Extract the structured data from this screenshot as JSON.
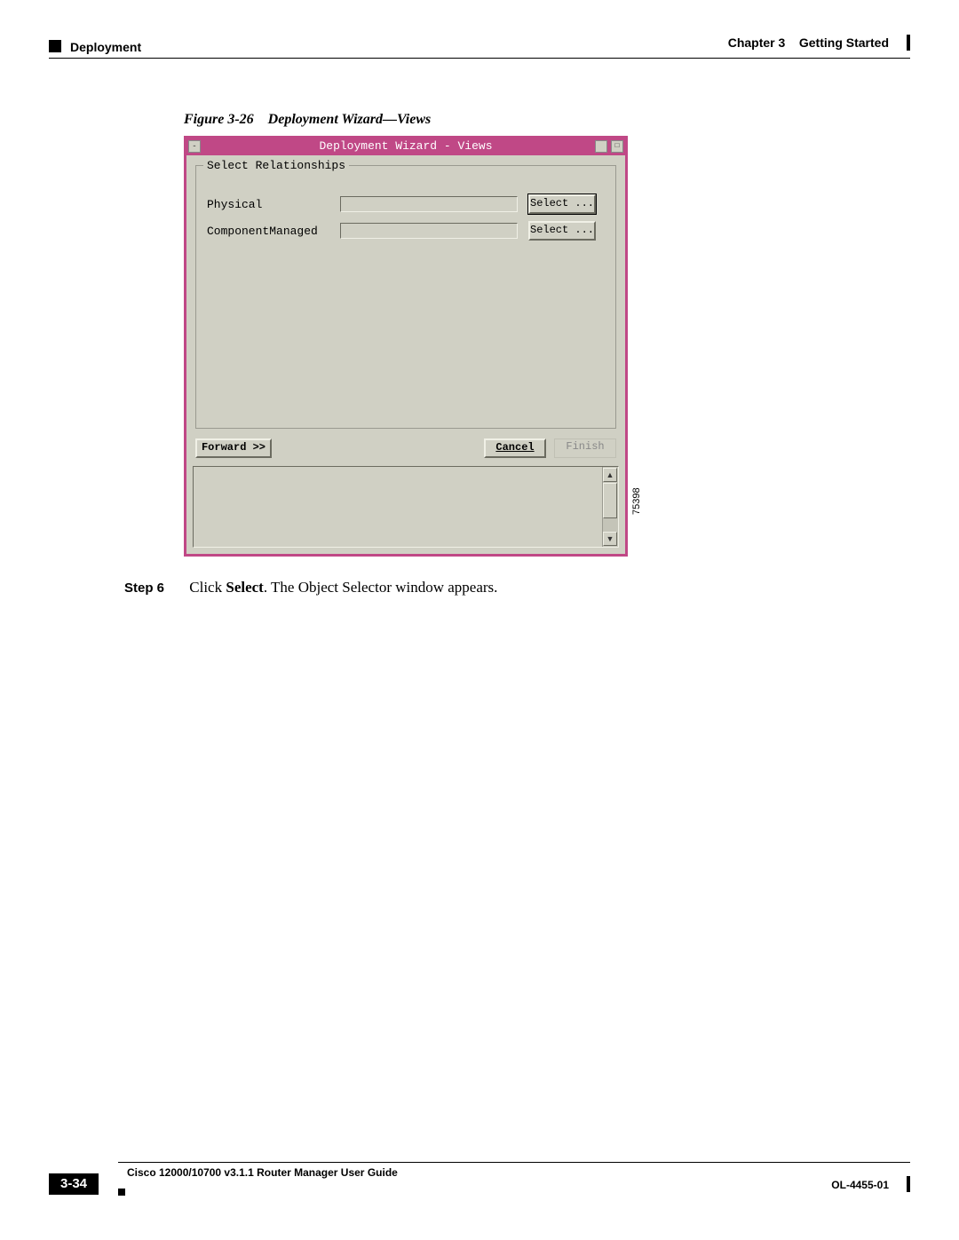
{
  "header": {
    "section": "Deployment",
    "chapter": "Chapter 3",
    "chapter_title": "Getting Started"
  },
  "figure": {
    "label": "Figure 3-26",
    "title": "Deployment Wizard—Views"
  },
  "wizard": {
    "title": "Deployment Wizard - Views",
    "group_title": "Select Relationships",
    "rows": [
      {
        "label": "Physical",
        "button": "Select ..."
      },
      {
        "label": "ComponentManaged",
        "button": "Select ..."
      }
    ],
    "nav": {
      "forward": "Forward >>",
      "cancel": "Cancel",
      "finish": "Finish"
    },
    "image_id": "75398"
  },
  "step": {
    "label": "Step 6",
    "pre": "Click ",
    "bold": "Select",
    "post": ". The Object Selector window appears."
  },
  "footer": {
    "guide": "Cisco 12000/10700 v3.1.1 Router Manager User Guide",
    "page": "3-34",
    "doc": "OL-4455-01"
  }
}
